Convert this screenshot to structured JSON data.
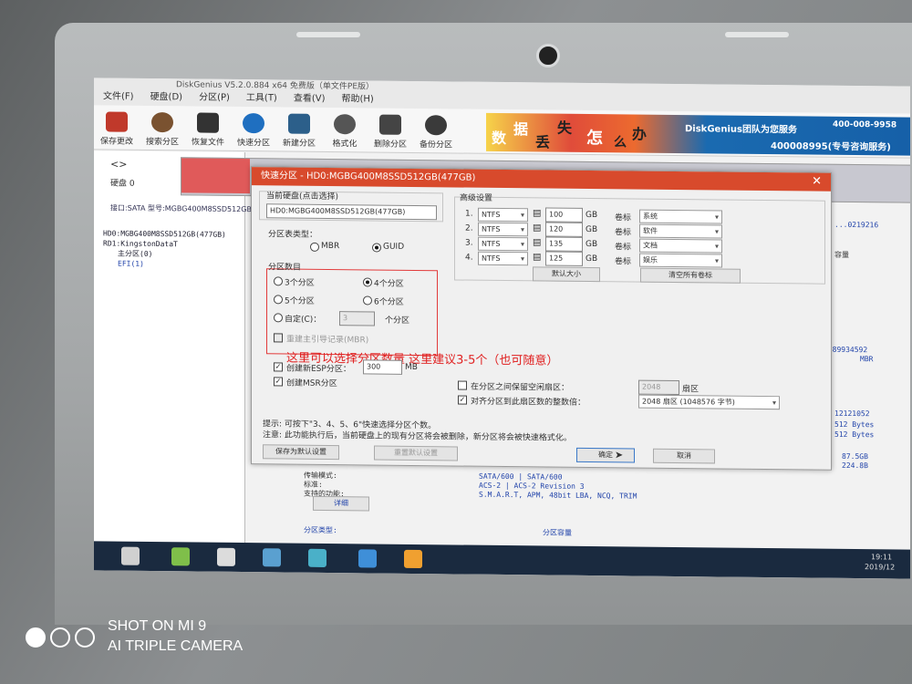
{
  "app": {
    "title": "DiskGenius V5.2.0.884 x64 免费版（单文件PE版）",
    "menus": [
      "文件(F)",
      "硬盘(D)",
      "分区(P)",
      "工具(T)",
      "查看(V)",
      "帮助(H)"
    ],
    "toolbar": [
      "保存更改",
      "搜索分区",
      "恢复文件",
      "快速分区",
      "新建分区",
      "格式化",
      "删除分区",
      "备份分区"
    ],
    "banner": {
      "chars": [
        "数",
        "据",
        "丢",
        "失",
        "怎",
        "么",
        "办"
      ],
      "brand": "DiskGenius团队为您服务",
      "phone1": "400-008-9958",
      "phone2": "400008995(专号咨询服务)"
    },
    "nav_label": "硬盘 0",
    "disk_info": "接口:SATA  型号:MGBG400M8SSD512GB",
    "tree": [
      "HD0:MGBG400M8SSD512GB(477GB)",
      "RD1:KingstonDataT",
      "主分区(0)",
      "EFI(1)"
    ],
    "right_info": [
      "...0219216",
      "容量",
      "8589934592",
      "MBR",
      "12121052",
      "512 Bytes",
      "512 Bytes",
      "87.5GB",
      "224.8B"
    ],
    "bottom_info": {
      "labels": [
        "传输模式:",
        "标准:",
        "支持的功能:",
        "详细"
      ],
      "values": [
        "SATA/600 | SATA/600",
        "ACS-2 | ACS-2 Revision 3",
        "S.M.A.R.T, APM, 48bit LBA, NCQ, TRIM"
      ],
      "footer_left": "分区类型:",
      "footer_right": "分区容量"
    }
  },
  "dialog": {
    "title": "快速分区 - HD0:MGBG400M8SSD512GB(477GB)",
    "close": "✕",
    "current_disk_label": "当前硬盘(点击选择)",
    "current_disk_value": "HD0:MGBG400M8SSD512GB(477GB)",
    "partition_table_label": "分区表类型：",
    "table_options": [
      "MBR",
      "GUID"
    ],
    "partition_count_label": "分区数目",
    "count_options": [
      "3个分区",
      "4个分区",
      "5个分区",
      "6个分区",
      "自定(C)："
    ],
    "custom_value": "3",
    "custom_suffix": "个分区",
    "rebuild_mbr": "重建主引导记录(MBR)",
    "create_esp": "创建新ESP分区：",
    "esp_size": "300",
    "esp_unit": "MB",
    "create_msr": "创建MSR分区",
    "advanced_label": "高级设置",
    "partitions": [
      {
        "no": "1.",
        "fs": "NTFS",
        "size": "100",
        "unit": "GB",
        "vol_label": "卷标",
        "name": "系统"
      },
      {
        "no": "2.",
        "fs": "NTFS",
        "size": "120",
        "unit": "GB",
        "vol_label": "卷标",
        "name": "软件"
      },
      {
        "no": "3.",
        "fs": "NTFS",
        "size": "135",
        "unit": "GB",
        "vol_label": "卷标",
        "name": "文档"
      },
      {
        "no": "4.",
        "fs": "NTFS",
        "size": "125",
        "unit": "GB",
        "vol_label": "卷标",
        "name": "娱乐"
      }
    ],
    "default_size_btn": "默认大小",
    "clear_labels_btn": "清空所有卷标",
    "reserve_label": "在分区之间保留空闲扇区：",
    "reserve_value": "2048",
    "reserve_unit": "扇区",
    "align_label": "对齐分区到此扇区数的整数倍：",
    "align_value": "2048 扇区 (1048576 字节)",
    "tip_line1": "提示:  可按下\"3、4、5、6\"快速选择分区个数。",
    "tip_line2": "注意:  此功能执行后，当前硬盘上的现有分区将会被删除，新分区将会被快速格式化。",
    "save_default_btn": "保存为默认设置",
    "reset_default_btn": "重置默认设置",
    "ok_btn": "确定",
    "cancel_btn": "取消",
    "annotation": "这里可以选择分区数量 这里建议3-5个（也可随意）"
  },
  "taskbar": {
    "clock": "19:11",
    "date": "2019/12"
  },
  "watermark": {
    "line1": "SHOT ON MI 9",
    "line2": "AI TRIPLE CAMERA"
  },
  "colors": {
    "dialog_title": "#d84a2c",
    "annotation": "#e02020",
    "taskbar": "#1a2a3f"
  }
}
